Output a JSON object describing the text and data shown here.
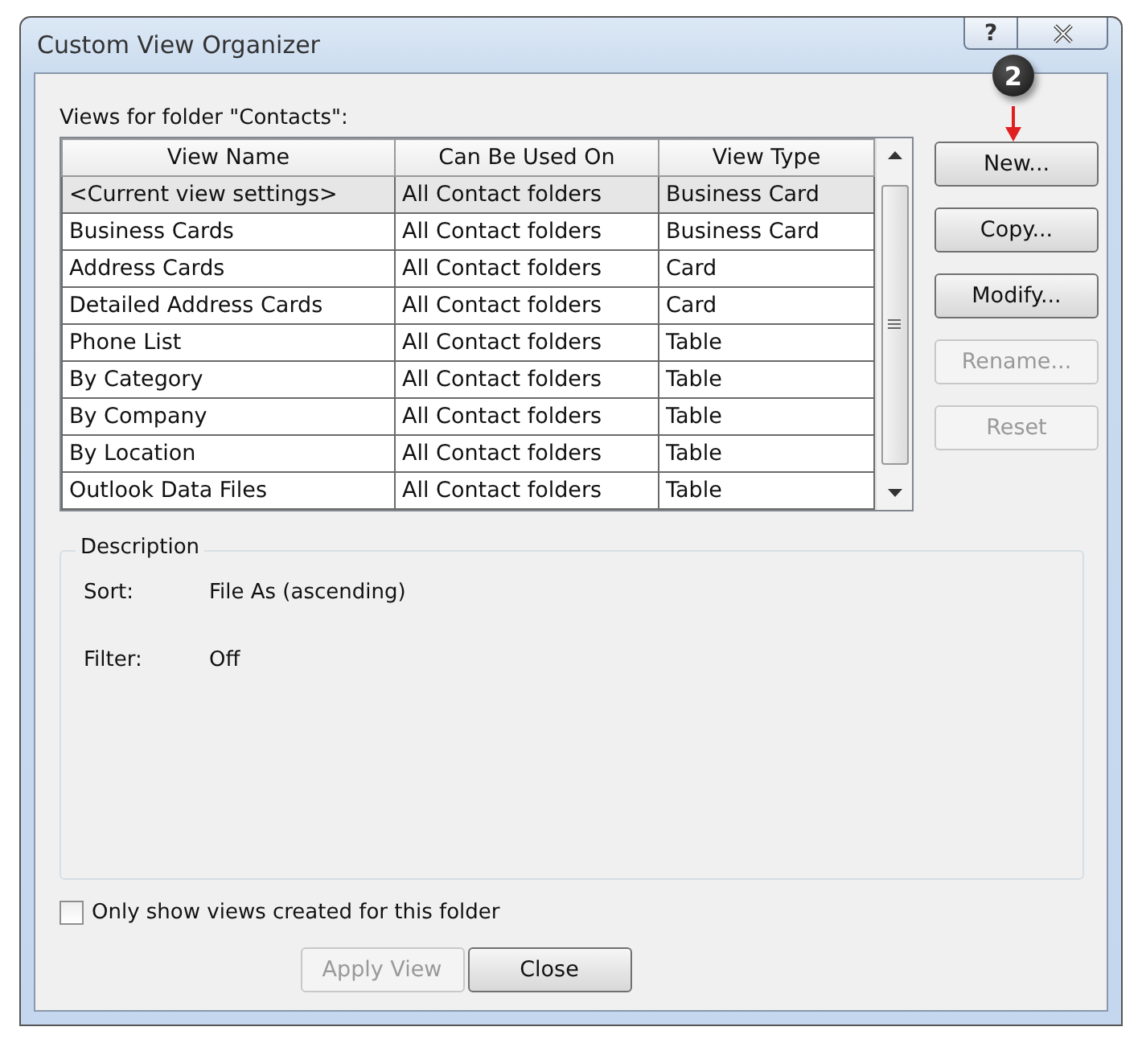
{
  "window": {
    "title": "Custom View Organizer",
    "help_button": "?"
  },
  "callout": {
    "text": "2"
  },
  "views_label": "Views for folder \"Contacts\":",
  "table": {
    "columns": [
      "View Name",
      "Can Be Used On",
      "View Type"
    ],
    "rows": [
      {
        "cells": [
          "<Current view settings>",
          "All Contact folders",
          "Business Card"
        ],
        "selected": true
      },
      {
        "cells": [
          "Business Cards",
          "All Contact folders",
          "Business Card"
        ],
        "selected": false
      },
      {
        "cells": [
          "Address Cards",
          "All Contact folders",
          "Card"
        ],
        "selected": false
      },
      {
        "cells": [
          "Detailed Address Cards",
          "All Contact folders",
          "Card"
        ],
        "selected": false
      },
      {
        "cells": [
          "Phone List",
          "All Contact folders",
          "Table"
        ],
        "selected": false
      },
      {
        "cells": [
          "By Category",
          "All Contact folders",
          "Table"
        ],
        "selected": false
      },
      {
        "cells": [
          "By Company",
          "All Contact folders",
          "Table"
        ],
        "selected": false
      },
      {
        "cells": [
          "By Location",
          "All Contact folders",
          "Table"
        ],
        "selected": false
      },
      {
        "cells": [
          "Outlook Data Files",
          "All Contact folders",
          "Table"
        ],
        "selected": false
      }
    ]
  },
  "side_buttons": [
    {
      "label": "New...",
      "disabled": false
    },
    {
      "label": "Copy...",
      "disabled": false
    },
    {
      "label": "Modify...",
      "disabled": false
    },
    {
      "label": "Rename...",
      "disabled": true
    },
    {
      "label": "Reset",
      "disabled": true
    }
  ],
  "description": {
    "title": "Description",
    "fields": [
      {
        "label": "Sort:",
        "value": "File As (ascending)"
      },
      {
        "label": "Filter:",
        "value": "Off"
      }
    ]
  },
  "checkbox": {
    "label": "Only show views created for this folder",
    "checked": false
  },
  "footer_buttons": [
    {
      "label": "Apply View",
      "disabled": true
    },
    {
      "label": "Close",
      "disabled": false
    }
  ]
}
